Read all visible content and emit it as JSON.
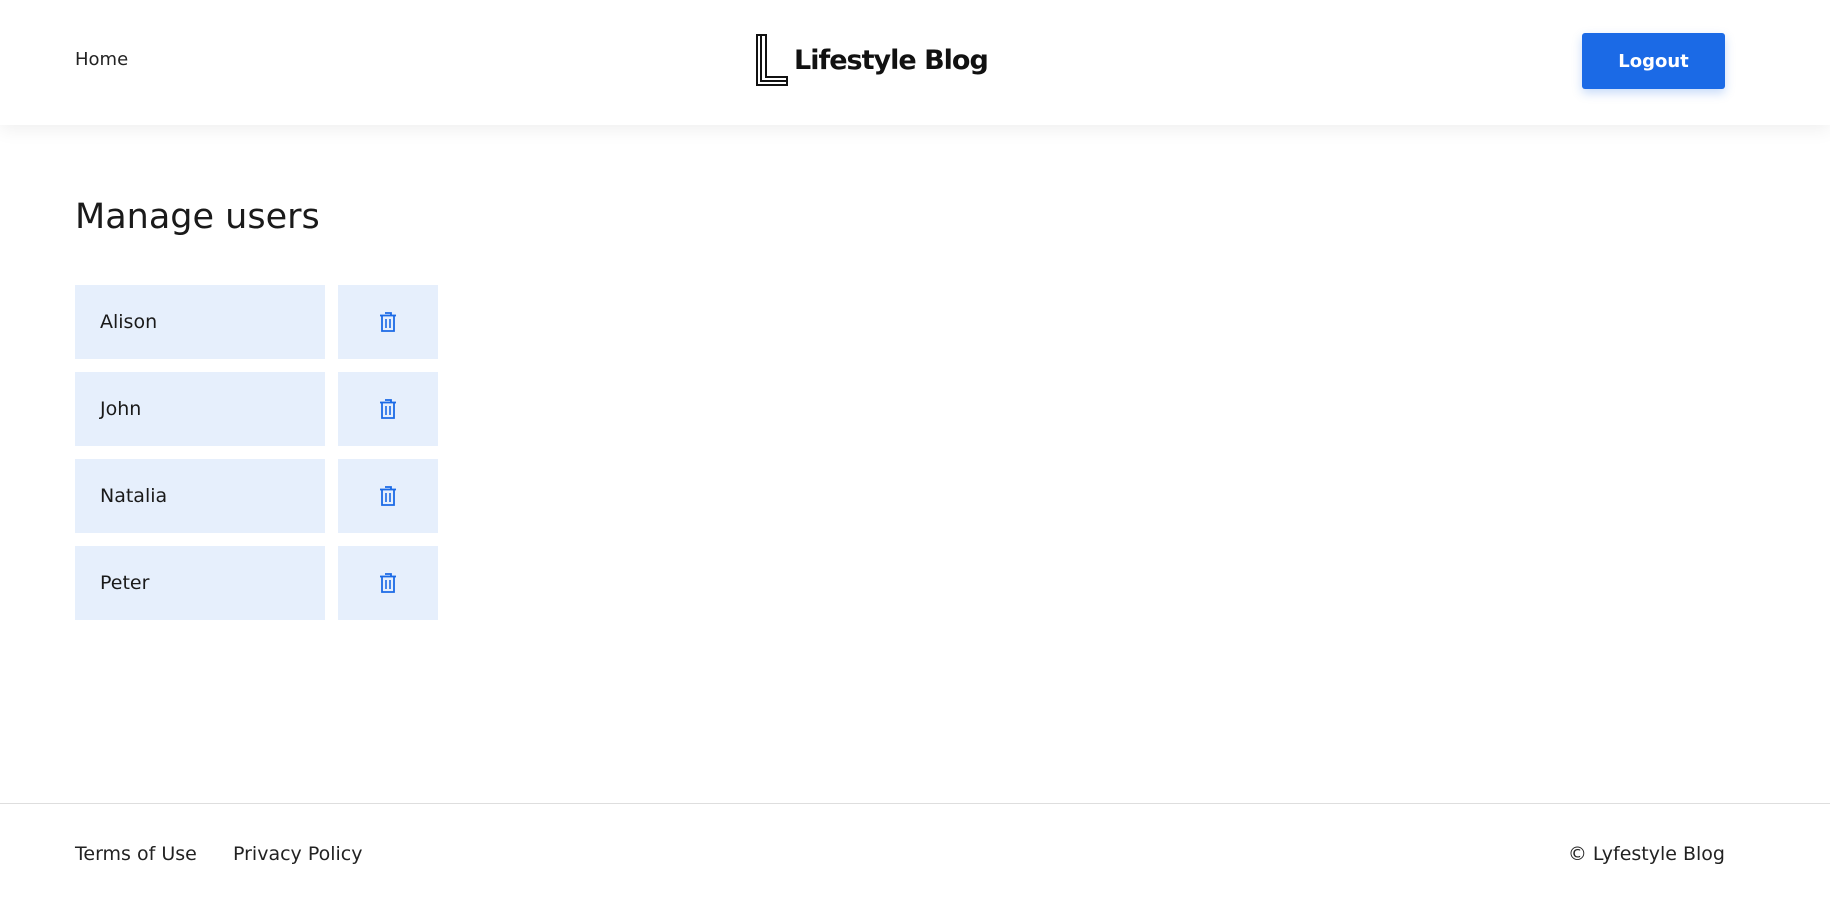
{
  "header": {
    "home_label": "Home",
    "logo_text": "Lifestyle Blog",
    "logout_label": "Logout"
  },
  "main": {
    "title": "Manage users",
    "users": [
      {
        "name": "Alison"
      },
      {
        "name": "John"
      },
      {
        "name": "Natalia"
      },
      {
        "name": "Peter"
      }
    ]
  },
  "footer": {
    "terms_label": "Terms of Use",
    "privacy_label": "Privacy Policy",
    "copyright": "© Lyfestyle Blog"
  },
  "icons": {
    "delete": "trash-icon",
    "logo": "logo-mark-icon"
  },
  "colors": {
    "accent": "#1b6ae6",
    "row_background": "#e6effc",
    "icon_color": "#1b6ae6"
  }
}
